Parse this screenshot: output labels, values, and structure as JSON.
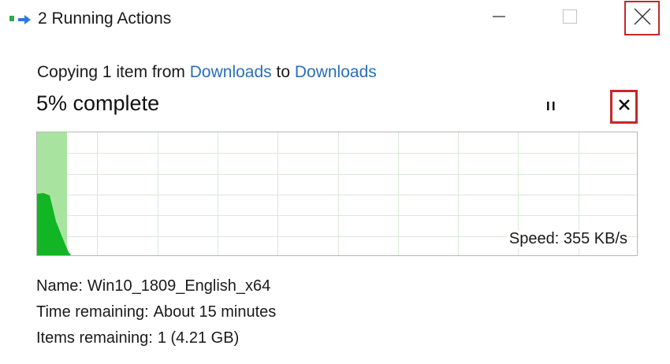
{
  "window": {
    "title": "2 Running Actions"
  },
  "operation": {
    "prefix": "Copying 1 item from",
    "source": "Downloads",
    "connector": "to",
    "destination": "Downloads",
    "percent_text": "5% complete",
    "progress_fraction": 0.05
  },
  "graph": {
    "speed_label": "Speed: 355 KB/s",
    "colors": {
      "progress_fill": "#a8e4a0",
      "speed_fill": "#12b524",
      "grid": "#d9e9d9"
    }
  },
  "details": {
    "name_key": "Name:",
    "name_value": "Win10_1809_English_x64",
    "time_key": "Time remaining:",
    "time_value": "About 15 minutes",
    "items_key": "Items remaining:",
    "items_value": "1 (4.21 GB)"
  },
  "icons": {
    "app": "file-copy-icon",
    "minimize": "minimize-icon",
    "maximize": "maximize-icon",
    "close": "close-icon",
    "pause": "pause-icon",
    "cancel": "cancel-icon"
  },
  "highlight_color": "#c62828"
}
